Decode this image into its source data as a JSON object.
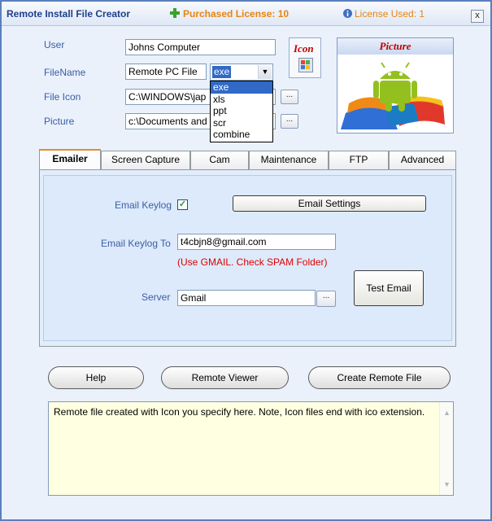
{
  "window": {
    "title": "Remote Install File Creator",
    "purchased": "Purchased License: 10",
    "used": "License Used: 1",
    "close_label": "x"
  },
  "form": {
    "user_label": "User",
    "user_value": "Johns Computer",
    "filename_label": "FileName",
    "filename_value": "Remote PC File",
    "filetype_selected": "exe",
    "filetype_options": [
      "exe",
      "xls",
      "ppt",
      "scr",
      "combine"
    ],
    "fileicon_label": "File Icon",
    "fileicon_value": "C:\\WINDOWS\\jap",
    "picture_label": "Picture",
    "picture_value": "c:\\Documents and",
    "browse_label": "..."
  },
  "icon_box": {
    "label": "Icon"
  },
  "picture_box": {
    "label": "Picture"
  },
  "tabs": [
    {
      "label": "Emailer",
      "active": true
    },
    {
      "label": "Screen Capture"
    },
    {
      "label": "Cam"
    },
    {
      "label": "Maintenance"
    },
    {
      "label": "FTP"
    },
    {
      "label": "Advanced"
    }
  ],
  "emailer": {
    "keylog_label": "Email Keylog",
    "keylog_checked": true,
    "settings_button": "Email Settings",
    "keylog_to_label": "Email Keylog To",
    "keylog_to_value": "t4cbjn8@gmail.com",
    "note": "(Use GMAIL. Check SPAM Folder)",
    "server_label": "Server",
    "server_value": "Gmail",
    "test_button": "Test Email"
  },
  "actions": {
    "help": "Help",
    "remote_viewer": "Remote Viewer",
    "create": "Create Remote File"
  },
  "description": "Remote file created with Icon you specify here. Note, Icon files end with ico extension.",
  "colors": {
    "title": "#1f3e8c",
    "license": "#e7850f",
    "label": "#3a5da6",
    "note": "#e00000",
    "selection": "#3169c6",
    "description_bg": "#ffffe1"
  }
}
